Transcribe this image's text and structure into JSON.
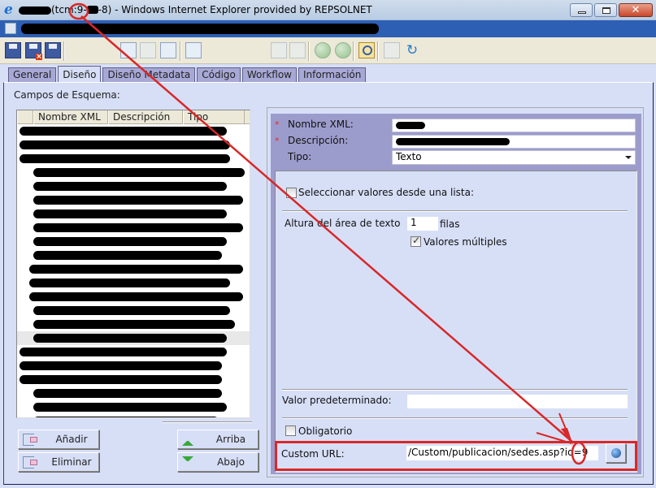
{
  "window": {
    "title_prefix": "(tcm",
    "title_mid": ":9-",
    "title_suffix": "-8)  -  Windows Internet Explorer provided by REPSOLNET",
    "controls": {
      "close": "✕"
    }
  },
  "toolbar": {
    "icons": [
      "save-icon",
      "save-close-icon",
      "save-new-icon",
      "check-in-icon",
      "check-out-icon",
      "undo-checkout-icon",
      "validate-icon",
      "localize-icon",
      "unlocalize-icon",
      "move-up-icon",
      "move-down-icon",
      "where-used-icon",
      "compare-icon",
      "refresh-icon"
    ]
  },
  "tabs": [
    {
      "label": "General",
      "active": false
    },
    {
      "label": "Diseño",
      "active": true
    },
    {
      "label": "Diseño Metadata",
      "active": false
    },
    {
      "label": "Código",
      "active": false
    },
    {
      "label": "Workflow",
      "active": false
    },
    {
      "label": "Información",
      "active": false
    }
  ],
  "schema": {
    "label": "Campos de Esquema:",
    "columns": [
      "Nombre XML",
      "Descripción",
      "Tipo"
    ],
    "row_count": 22,
    "selected_row": 15,
    "buttons": {
      "add": "Añadir",
      "remove": "Eliminar",
      "up": "Arriba",
      "down": "Abajo"
    }
  },
  "field": {
    "xml_name_label": "Nombre XML:",
    "description_label": "Descripción:",
    "type_label": "Tipo:",
    "type_value": "Texto",
    "required_marker": "*",
    "select_from_list_label": "Seleccionar valores desde una lista:",
    "select_from_list_checked": false,
    "text_height_label": "Altura del área de texto",
    "text_height_value": "1",
    "text_height_unit": "filas",
    "multi_values_label": "Valores múltiples",
    "multi_values_checked": true,
    "default_value_label": "Valor predeterminado:",
    "default_value": "",
    "mandatory_label": "Obligatorio",
    "mandatory_checked": false,
    "custom_url_label": "Custom URL:",
    "custom_url_value": "/Custom/publicacion/sedes.asp?id=9"
  },
  "annotation": {
    "color": "#d82828"
  }
}
